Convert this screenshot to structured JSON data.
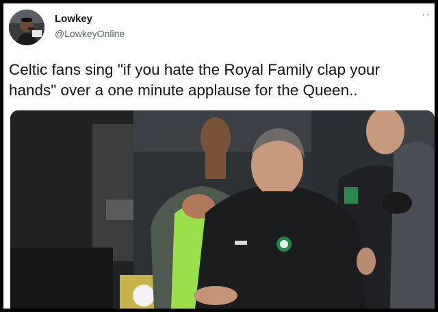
{
  "tweet": {
    "display_name": "Lowkey",
    "handle": "@LowkeyOnline",
    "more_icon": "more-horizontal-icon",
    "text_line1": "Celtic fans sing \"if you hate the Royal Family clap your",
    "text_line2": "hands\" over a one minute applause for the Queen.."
  },
  "colors": {
    "text": "#0f1419",
    "secondary": "#536471",
    "frame": "#000000",
    "bib": "#9be04a",
    "celtic_green": "#1e8a4c"
  }
}
